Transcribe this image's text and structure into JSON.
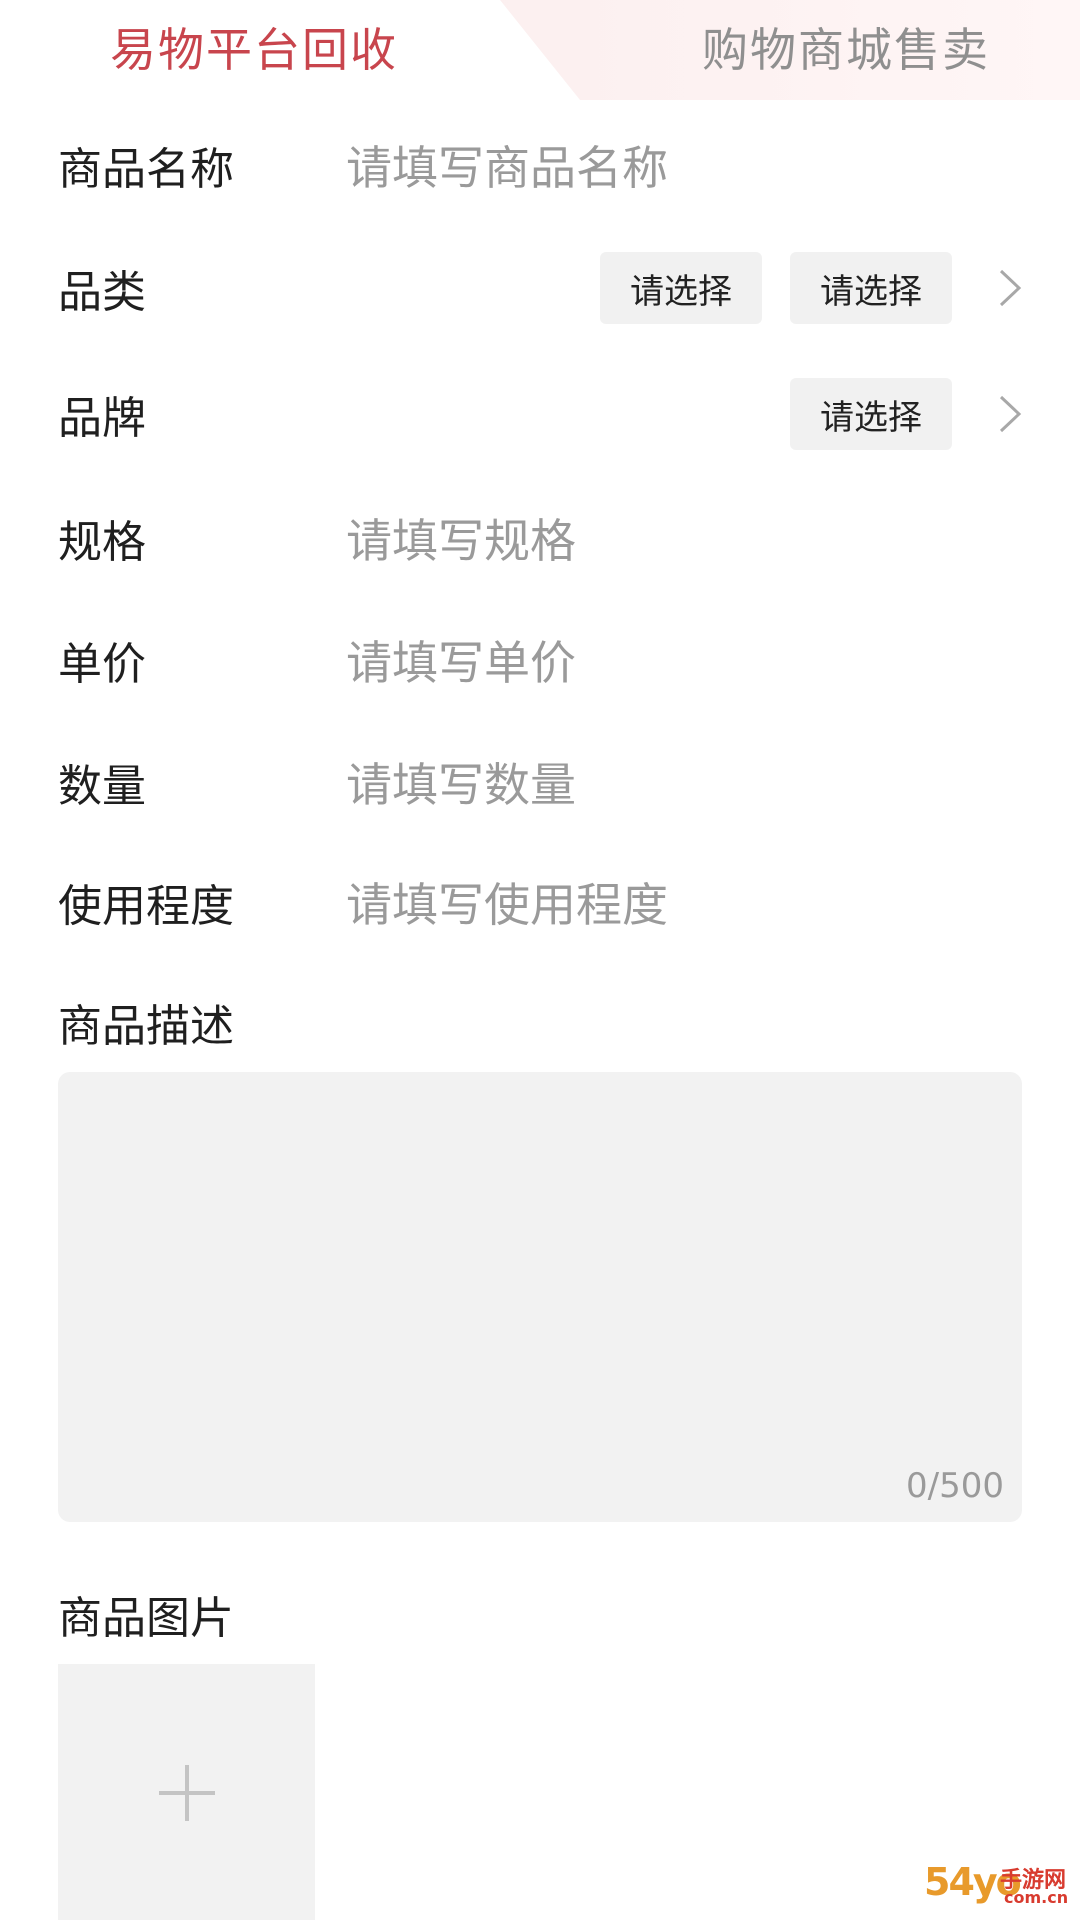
{
  "tabs": [
    {
      "label": "易物平台回收",
      "active": true
    },
    {
      "label": "购物商城售卖",
      "active": false
    }
  ],
  "colors": {
    "accent": "#c8454d",
    "placeholder": "#9a9a9a",
    "box_bg": "#f2f2f2"
  },
  "form": {
    "name": {
      "label": "商品名称",
      "placeholder": "请填写商品名称"
    },
    "category": {
      "label": "品类",
      "option1": "请选择",
      "option2": "请选择"
    },
    "brand": {
      "label": "品牌",
      "option": "请选择"
    },
    "spec": {
      "label": "规格",
      "placeholder": "请填写规格"
    },
    "price": {
      "label": "单价",
      "placeholder": "请填写单价"
    },
    "quantity": {
      "label": "数量",
      "placeholder": "请填写数量"
    },
    "usage": {
      "label": "使用程度",
      "placeholder": "请填写使用程度"
    }
  },
  "description": {
    "label": "商品描述",
    "counter": "0/500"
  },
  "images": {
    "label": "商品图片",
    "add_icon": "plus-icon"
  },
  "watermark": {
    "main": "54yo",
    "side": "手游网",
    "domain": "com.cn"
  }
}
